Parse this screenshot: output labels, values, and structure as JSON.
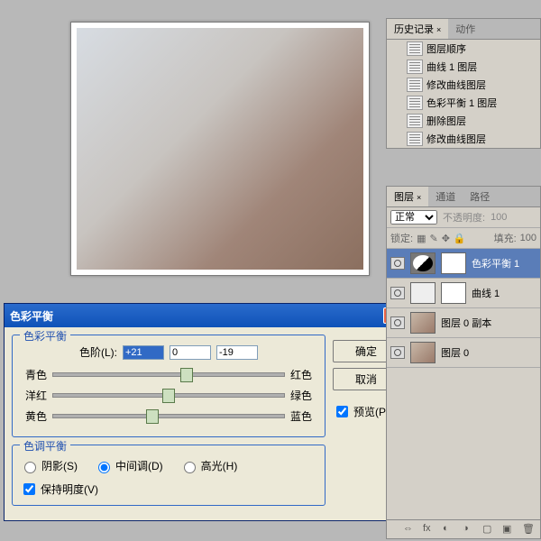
{
  "dialog": {
    "title": "色彩平衡",
    "section1_label": "色彩平衡",
    "levels_label": "色阶(L):",
    "level1": "+21",
    "level2": "0",
    "level3": "-19",
    "sliders": [
      {
        "left": "青色",
        "right": "红色",
        "pos": 58
      },
      {
        "left": "洋红",
        "right": "绿色",
        "pos": 50
      },
      {
        "left": "黄色",
        "right": "蓝色",
        "pos": 43
      }
    ],
    "section2_label": "色调平衡",
    "radios": {
      "shadow": "阴影(S)",
      "mid": "中间调(D)",
      "high": "高光(H)"
    },
    "preserve": "保持明度(V)",
    "ok": "确定",
    "cancel": "取消",
    "preview": "预览(P)"
  },
  "history": {
    "tab1": "历史记录",
    "tab2": "动作",
    "items": [
      "图层顺序",
      "曲线 1 图层",
      "修改曲线图层",
      "色彩平衡 1 图层",
      "删除图层",
      "修改曲线图层"
    ]
  },
  "layers": {
    "t1": "图层",
    "t2": "通道",
    "t3": "路径",
    "blend": "正常",
    "opacity_label": "不透明度:",
    "opacity": "100",
    "lock_label": "锁定:",
    "fill_label": "填充:",
    "fill": "100",
    "items": [
      {
        "name": "色彩平衡 1",
        "type": "adj",
        "sel": true
      },
      {
        "name": "曲线 1",
        "type": "curve"
      },
      {
        "name": "图层 0 副本",
        "type": "photo"
      },
      {
        "name": "图层 0",
        "type": "photo"
      }
    ]
  }
}
